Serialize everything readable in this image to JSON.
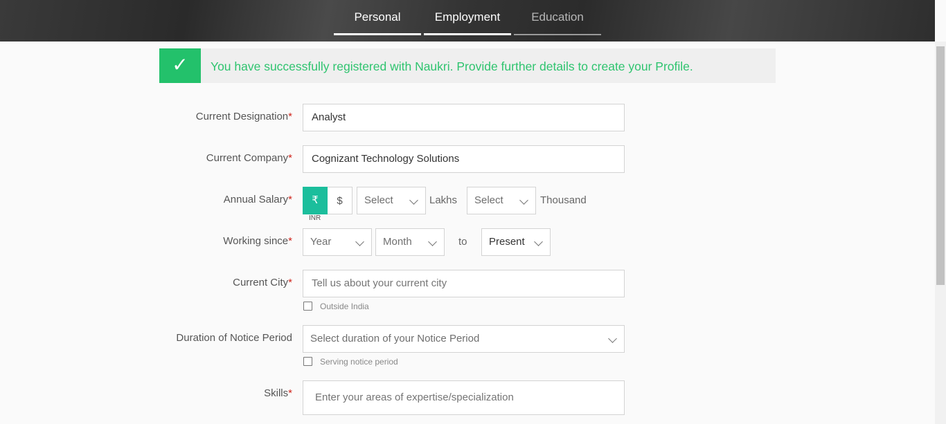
{
  "tabs": [
    {
      "label": "Personal"
    },
    {
      "label": "Employment"
    },
    {
      "label": "Education"
    }
  ],
  "banner": {
    "icon": "check-icon",
    "message": "You have successfully registered with Naukri. Provide further details to create your Profile."
  },
  "form": {
    "designation": {
      "label": "Current Designation",
      "required": "*",
      "value": "Analyst"
    },
    "company": {
      "label": "Current Company",
      "required": "*",
      "value": "Cognizant Technology Solutions"
    },
    "salary": {
      "label": "Annual Salary",
      "required": "*",
      "currency_inr": "₹",
      "currency_usd": "$",
      "currency_caption": "INR",
      "lakhs_select": "Select",
      "lakhs_unit": "Lakhs",
      "thousand_select": "Select",
      "thousand_unit": "Thousand"
    },
    "working_since": {
      "label": "Working since",
      "required": "*",
      "year": "Year",
      "month": "Month",
      "to": "to",
      "present": "Present"
    },
    "city": {
      "label": "Current City",
      "required": "*",
      "placeholder": "Tell us about your current city",
      "checkbox_label": "Outside India"
    },
    "notice": {
      "label": "Duration of Notice Period",
      "placeholder": "Select duration of your Notice Period",
      "checkbox_label": "Serving notice period"
    },
    "skills": {
      "label": "Skills",
      "required": "*",
      "placeholder": "Enter your areas of expertise/specialization"
    }
  },
  "colors": {
    "success_green": "#23c16b",
    "currency_active": "#1bbe9c",
    "required_red": "#d0231a"
  }
}
